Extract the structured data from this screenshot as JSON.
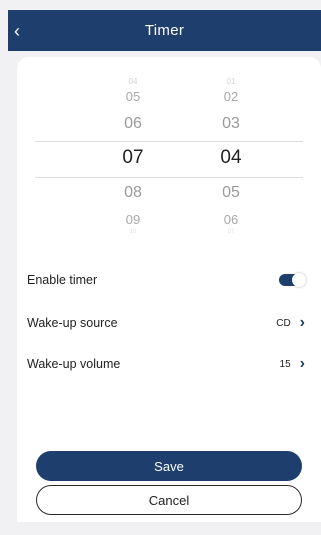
{
  "header": {
    "title": "Timer",
    "back_glyph": "‹"
  },
  "picker": {
    "hours": {
      "far_above": "04",
      "above2": "05",
      "above": "06",
      "selected": "07",
      "below": "08",
      "below2": "09",
      "far_below": "10"
    },
    "minutes": {
      "far_above": "01",
      "above2": "02",
      "above": "03",
      "selected": "04",
      "below": "05",
      "below2": "06",
      "far_below": "07"
    }
  },
  "settings": {
    "enable_timer": {
      "label": "Enable timer",
      "enabled": true
    },
    "wake_up_source": {
      "label": "Wake-up source",
      "value": "CD"
    },
    "wake_up_volume": {
      "label": "Wake-up volume",
      "value": "15"
    }
  },
  "buttons": {
    "save": "Save",
    "cancel": "Cancel"
  },
  "icons": {
    "back": "chevron-left-icon",
    "next": "chevron-right-icon"
  },
  "colors": {
    "accent": "#1e3f6e",
    "background": "#f1f1f3",
    "card": "#ffffff"
  }
}
